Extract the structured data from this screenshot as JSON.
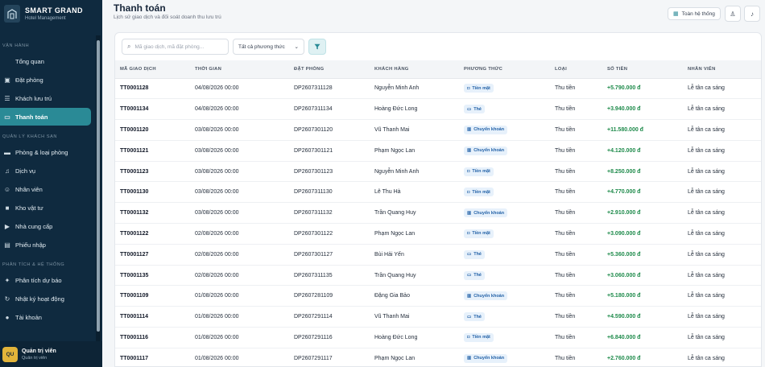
{
  "brand": {
    "name": "SMART GRAND",
    "subtitle": "Hotel Management"
  },
  "sidebar": {
    "sections": [
      {
        "label": "VẬN HÀNH",
        "items": [
          {
            "label": "Tổng quan",
            "icon": "none",
            "active": false
          },
          {
            "label": "Đặt phòng",
            "icon": "calendar-icon",
            "active": false
          },
          {
            "label": "Khách lưu trú",
            "icon": "guest-icon",
            "active": false
          },
          {
            "label": "Thanh toán",
            "icon": "card-icon",
            "active": true
          }
        ]
      },
      {
        "label": "QUẢN LÝ KHÁCH SẠN",
        "items": [
          {
            "label": "Phòng & loại phòng",
            "icon": "bed-icon",
            "active": false
          },
          {
            "label": "Dịch vụ",
            "icon": "bell-icon",
            "active": false
          },
          {
            "label": "Nhân viên",
            "icon": "staff-icon",
            "active": false
          },
          {
            "label": "Kho vật tư",
            "icon": "box-icon",
            "active": false
          },
          {
            "label": "Nhà cung cấp",
            "icon": "truck-icon",
            "active": false
          },
          {
            "label": "Phiếu nhập",
            "icon": "receipt-icon",
            "active": false
          }
        ]
      },
      {
        "label": "PHÂN TÍCH & HỆ THỐNG",
        "items": [
          {
            "label": "Phân tích dự báo",
            "icon": "chart-icon",
            "active": false
          },
          {
            "label": "Nhật ký hoạt động",
            "icon": "log-icon",
            "active": false
          },
          {
            "label": "Tài khoản",
            "icon": "account-icon",
            "active": false
          }
        ]
      }
    ]
  },
  "user": {
    "initials": "QU",
    "name": "Quản trị viên",
    "role": "Quản trị viên"
  },
  "header": {
    "title": "Thanh toán",
    "subtitle": "Lịch sử giao dịch và đối soát doanh thu lưu trú",
    "help_label": "Toàn hệ thống"
  },
  "toolbar": {
    "search_placeholder": "Mã giao dịch, mã đặt phòng...",
    "method_selected": "Tất cả phương thức"
  },
  "table": {
    "columns": [
      "MÃ GIAO DỊCH",
      "THỜI GIAN",
      "ĐẶT PHÒNG",
      "KHÁCH HÀNG",
      "PHƯƠNG THỨC",
      "LOẠI",
      "SỐ TIỀN",
      "NHÂN VIÊN"
    ],
    "rows": [
      {
        "code": "TT0001128",
        "time": "04/08/2026 00:00",
        "booking": "DP2607311128",
        "guest": "Nguyễn Minh Anh",
        "method": "Tiền mặt",
        "type": "Thu tiền",
        "amount": "+5.790.000 đ",
        "staff": "Lễ tân ca sáng"
      },
      {
        "code": "TT0001134",
        "time": "04/08/2026 00:00",
        "booking": "DP2607311134",
        "guest": "Hoàng Đức Long",
        "method": "Thẻ",
        "type": "Thu tiền",
        "amount": "+3.940.000 đ",
        "staff": "Lễ tân ca sáng"
      },
      {
        "code": "TT0001120",
        "time": "03/08/2026 00:00",
        "booking": "DP2607301120",
        "guest": "Vũ Thanh Mai",
        "method": "Chuyển khoản",
        "type": "Thu tiền",
        "amount": "+11.580.000 đ",
        "staff": "Lễ tân ca sáng"
      },
      {
        "code": "TT0001121",
        "time": "03/08/2026 00:00",
        "booking": "DP2607301121",
        "guest": "Phạm Ngọc Lan",
        "method": "Chuyển khoản",
        "type": "Thu tiền",
        "amount": "+4.120.000 đ",
        "staff": "Lễ tân ca sáng"
      },
      {
        "code": "TT0001123",
        "time": "03/08/2026 00:00",
        "booking": "DP2607301123",
        "guest": "Nguyễn Minh Anh",
        "method": "Tiền mặt",
        "type": "Thu tiền",
        "amount": "+8.250.000 đ",
        "staff": "Lễ tân ca sáng"
      },
      {
        "code": "TT0001130",
        "time": "03/08/2026 00:00",
        "booking": "DP2607311130",
        "guest": "Lê Thu Hà",
        "method": "Tiền mặt",
        "type": "Thu tiền",
        "amount": "+4.770.000 đ",
        "staff": "Lễ tân ca sáng"
      },
      {
        "code": "TT0001132",
        "time": "03/08/2026 00:00",
        "booking": "DP2607311132",
        "guest": "Trần Quang Huy",
        "method": "Chuyển khoản",
        "type": "Thu tiền",
        "amount": "+2.910.000 đ",
        "staff": "Lễ tân ca sáng"
      },
      {
        "code": "TT0001122",
        "time": "02/08/2026 00:00",
        "booking": "DP2607301122",
        "guest": "Phạm Ngọc Lan",
        "method": "Tiền mặt",
        "type": "Thu tiền",
        "amount": "+3.090.000 đ",
        "staff": "Lễ tân ca sáng"
      },
      {
        "code": "TT0001127",
        "time": "02/08/2026 00:00",
        "booking": "DP2607301127",
        "guest": "Bùi Hải Yến",
        "method": "Thẻ",
        "type": "Thu tiền",
        "amount": "+5.360.000 đ",
        "staff": "Lễ tân ca sáng"
      },
      {
        "code": "TT0001135",
        "time": "02/08/2026 00:00",
        "booking": "DP2607311135",
        "guest": "Trần Quang Huy",
        "method": "Thẻ",
        "type": "Thu tiền",
        "amount": "+3.060.000 đ",
        "staff": "Lễ tân ca sáng"
      },
      {
        "code": "TT0001109",
        "time": "01/08/2026 00:00",
        "booking": "DP2607281109",
        "guest": "Đặng Gia Bảo",
        "method": "Chuyển khoản",
        "type": "Thu tiền",
        "amount": "+5.180.000 đ",
        "staff": "Lễ tân ca sáng"
      },
      {
        "code": "TT0001114",
        "time": "01/08/2026 00:00",
        "booking": "DP2607291114",
        "guest": "Vũ Thanh Mai",
        "method": "Thẻ",
        "type": "Thu tiền",
        "amount": "+4.590.000 đ",
        "staff": "Lễ tân ca sáng"
      },
      {
        "code": "TT0001116",
        "time": "01/08/2026 00:00",
        "booking": "DP2607291116",
        "guest": "Hoàng Đức Long",
        "method": "Tiền mặt",
        "type": "Thu tiền",
        "amount": "+6.840.000 đ",
        "staff": "Lễ tân ca sáng"
      },
      {
        "code": "TT0001117",
        "time": "01/08/2026 00:00",
        "booking": "DP2607291117",
        "guest": "Phạm Ngọc Lan",
        "method": "Chuyển khoản",
        "type": "Thu tiền",
        "amount": "+2.760.000 đ",
        "staff": "Lễ tân ca sáng"
      }
    ]
  },
  "colors": {
    "sidebar": "#0f2a3f",
    "active": "#2a8a96",
    "amount": "#1d8a4a",
    "badge": "#e7f1fb"
  }
}
